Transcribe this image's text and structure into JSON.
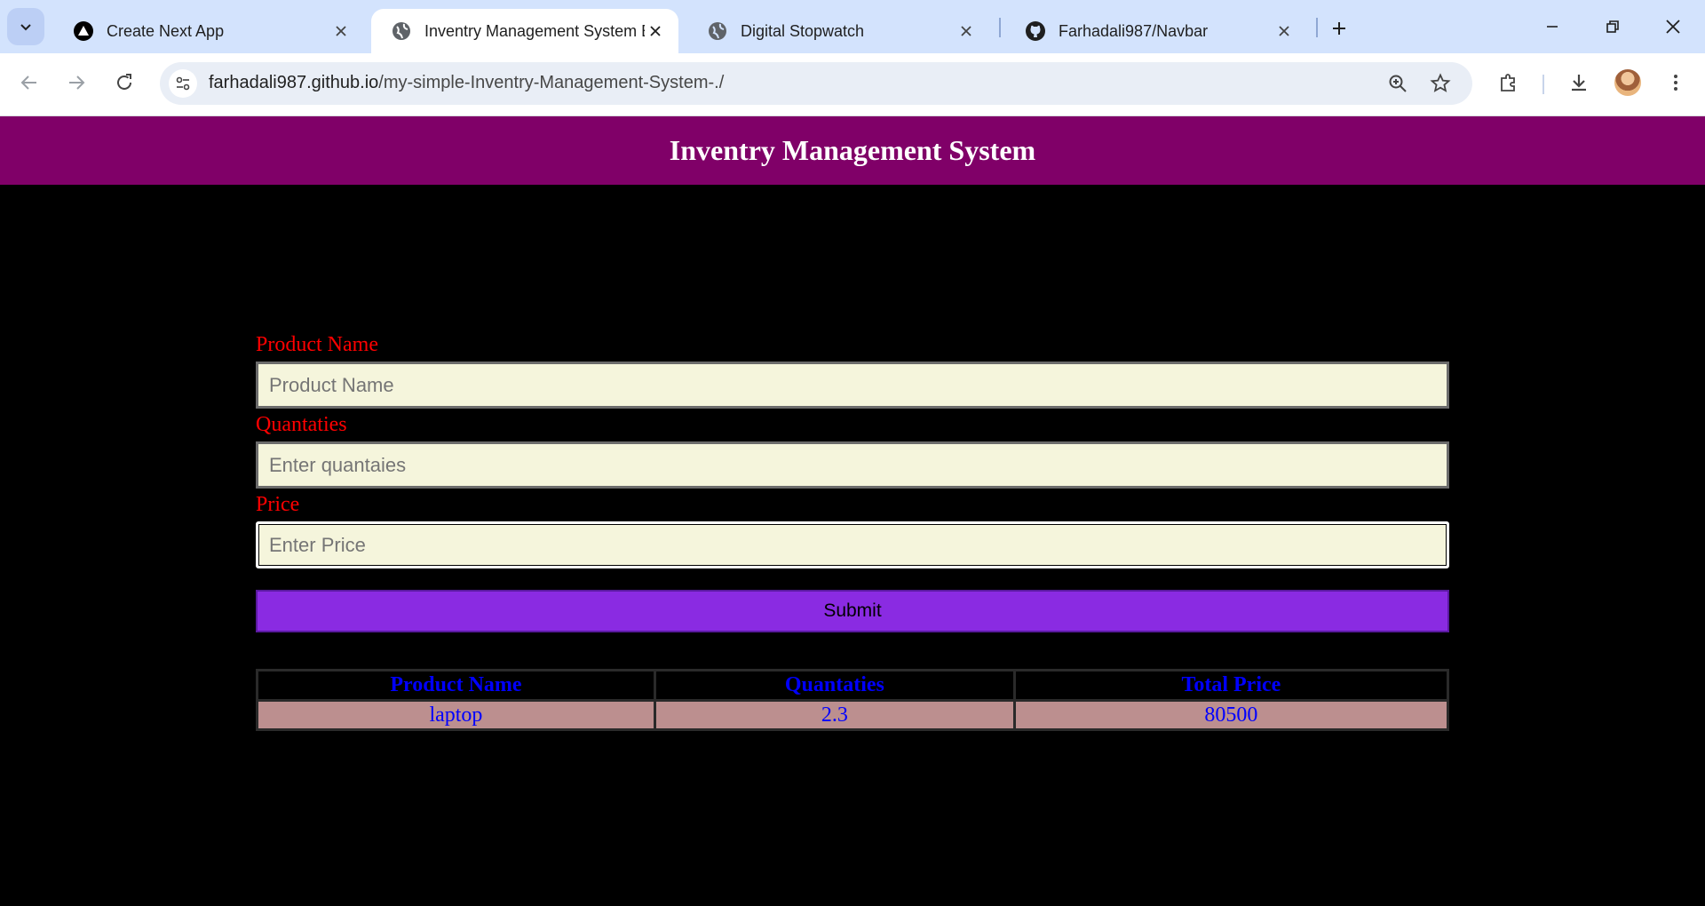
{
  "browser": {
    "tabs": [
      {
        "title": "Create Next App",
        "icon": "nextjs-icon",
        "active": false
      },
      {
        "title": "Inventry Management System Bookmark",
        "icon": "globe-icon",
        "active": true
      },
      {
        "title": "Digital Stopwatch",
        "icon": "globe-icon",
        "active": false
      },
      {
        "title": "Farhadali987/Navbar",
        "icon": "github-icon",
        "active": false
      }
    ],
    "url_domain": "farhadali987.github.io",
    "url_path": "/my-simple-Inventry-Management-System-./"
  },
  "page": {
    "title": "Inventry Management System",
    "form": {
      "product_label": "Product Name",
      "product_placeholder": "Product Name",
      "quantity_label": "Quantaties",
      "quantity_placeholder": "Enter quantaies",
      "price_label": "Price",
      "price_placeholder": "Enter Price",
      "submit_label": "Submit"
    },
    "table": {
      "headers": [
        "Product Name",
        "Quantaties",
        "Total Price"
      ],
      "rows": [
        [
          "laptop",
          "2.3",
          "80500"
        ]
      ]
    }
  },
  "colors": {
    "header_bg": "#800068",
    "label": "#ff0000",
    "input_bg": "#f5f5dc",
    "submit_bg": "#8a2be2",
    "table_text": "#0000ff",
    "row_bg": "#bc8f8f"
  }
}
